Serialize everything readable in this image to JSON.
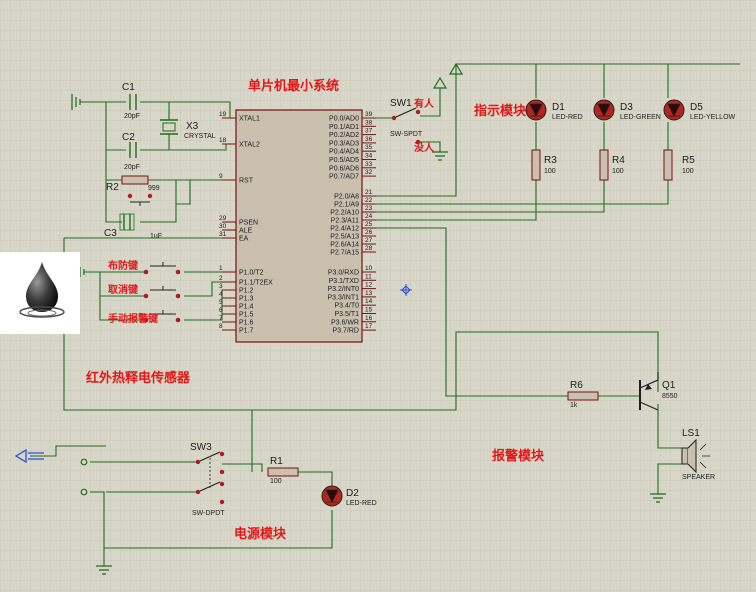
{
  "titles": {
    "mcu_system": "单片机最小系统",
    "indicator": "指示模块",
    "pir_sensor": "红外热释电传感器",
    "alarm": "报警模块",
    "power": "电源模块"
  },
  "mcu": {
    "left_pins": [
      {
        "num": "19",
        "name": "XTAL1"
      },
      {
        "num": "18",
        "name": "XTAL2"
      },
      {
        "num": "9",
        "name": "RST"
      },
      {
        "num": "29",
        "name": "PSEN"
      },
      {
        "num": "30",
        "name": "ALE"
      },
      {
        "num": "31",
        "name": "EA"
      },
      {
        "num": "1",
        "name": "P1.0/T2"
      },
      {
        "num": "2",
        "name": "P1.1/T2EX"
      },
      {
        "num": "3",
        "name": "P1.2"
      },
      {
        "num": "4",
        "name": "P1.3"
      },
      {
        "num": "5",
        "name": "P1.4"
      },
      {
        "num": "6",
        "name": "P1.5"
      },
      {
        "num": "7",
        "name": "P1.6"
      },
      {
        "num": "8",
        "name": "P1.7"
      }
    ],
    "right_pins": [
      {
        "num": "39",
        "name": "P0.0/AD0"
      },
      {
        "num": "38",
        "name": "P0.1/AD1"
      },
      {
        "num": "37",
        "name": "P0.2/AD2"
      },
      {
        "num": "36",
        "name": "P0.3/AD3"
      },
      {
        "num": "35",
        "name": "P0.4/AD4"
      },
      {
        "num": "34",
        "name": "P0.5/AD5"
      },
      {
        "num": "33",
        "name": "P0.6/AD6"
      },
      {
        "num": "32",
        "name": "P0.7/AD7"
      },
      {
        "num": "21",
        "name": "P2.0/A8"
      },
      {
        "num": "22",
        "name": "P2.1/A9"
      },
      {
        "num": "23",
        "name": "P2.2/A10"
      },
      {
        "num": "24",
        "name": "P2.3/A11"
      },
      {
        "num": "25",
        "name": "P2.4/A12"
      },
      {
        "num": "26",
        "name": "P2.5/A13"
      },
      {
        "num": "27",
        "name": "P2.6/A14"
      },
      {
        "num": "28",
        "name": "P2.7/A15"
      },
      {
        "num": "10",
        "name": "P3.0/RXD"
      },
      {
        "num": "11",
        "name": "P3.1/TXD"
      },
      {
        "num": "12",
        "name": "P3.2/INT0"
      },
      {
        "num": "13",
        "name": "P3.3/INT1"
      },
      {
        "num": "14",
        "name": "P3.4/T0"
      },
      {
        "num": "15",
        "name": "P3.5/T1"
      },
      {
        "num": "16",
        "name": "P3.6/WR"
      },
      {
        "num": "17",
        "name": "P3.7/RD"
      }
    ]
  },
  "components": {
    "c1": {
      "ref": "C1",
      "value": "20pF"
    },
    "c2": {
      "ref": "C2",
      "value": "20pF"
    },
    "x3": {
      "ref": "X3",
      "value": "CRYSTAL"
    },
    "r2": {
      "ref": "R2",
      "value": "999"
    },
    "c3": {
      "ref": "C3",
      "value": "1uF"
    },
    "sw1": {
      "ref": "SW1",
      "value": "SW-SPDT",
      "label_on": "有人",
      "label_off": "没人"
    },
    "d1": {
      "ref": "D1",
      "value": "LED-RED"
    },
    "d3": {
      "ref": "D3",
      "value": "LED-GREEN"
    },
    "d5": {
      "ref": "D5",
      "value": "LED-YELLOW"
    },
    "r3": {
      "ref": "R3",
      "value": "100"
    },
    "r4": {
      "ref": "R4",
      "value": "100"
    },
    "r5": {
      "ref": "R5",
      "value": "100"
    },
    "r6": {
      "ref": "R6",
      "value": "1k"
    },
    "q1": {
      "ref": "Q1",
      "value": "8550"
    },
    "ls1": {
      "ref": "LS1",
      "value": "SPEAKER"
    },
    "sw3": {
      "ref": "SW3",
      "value": "SW-DPDT"
    },
    "r1": {
      "ref": "R1",
      "value": "100"
    },
    "d2": {
      "ref": "D2",
      "value": "LED-RED"
    }
  },
  "buttons": {
    "arm": "布防键",
    "disarm": "取消键",
    "manual_alarm": "手动报警键"
  },
  "colors": {
    "background": "#d8d6c8",
    "grid": "#c8c5b3",
    "wire": "#1f6e1f",
    "chip_fill": "#c9c0b0",
    "chip_border": "#7a1010",
    "pin": "#7a1010",
    "title_red": "#e01818",
    "text_dark": "#202020",
    "led_fill": "#b3261e"
  }
}
